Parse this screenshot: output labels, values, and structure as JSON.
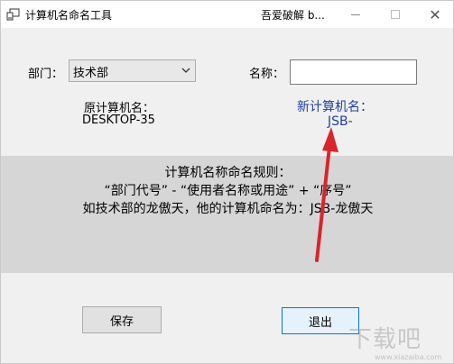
{
  "titlebar": {
    "title": "计算机名命名工具",
    "extra": "吾爱破解 b..."
  },
  "form": {
    "dept_label": "部门：",
    "dept_selected": "技术部",
    "name_label": "名称：",
    "name_value": "",
    "orig_label": "原计算机名：",
    "orig_value": "DESKTOP-35",
    "new_label": "新计算机名：",
    "new_value": "JSB-"
  },
  "rules": {
    "line1": "计算机名称命名规则：",
    "line2": "“部门代号” - “使用者名称或用途” + “序号”",
    "line3": "如技术部的龙傲天，他的计算机命名为：JSB-龙傲天"
  },
  "buttons": {
    "save": "保存",
    "exit": "退出"
  },
  "watermark": {
    "main": "下载吧",
    "sub": "www.xiazaiba.com"
  },
  "colors": {
    "accent_blue": "#1f3fa6",
    "arrow_red": "#d9252b"
  }
}
